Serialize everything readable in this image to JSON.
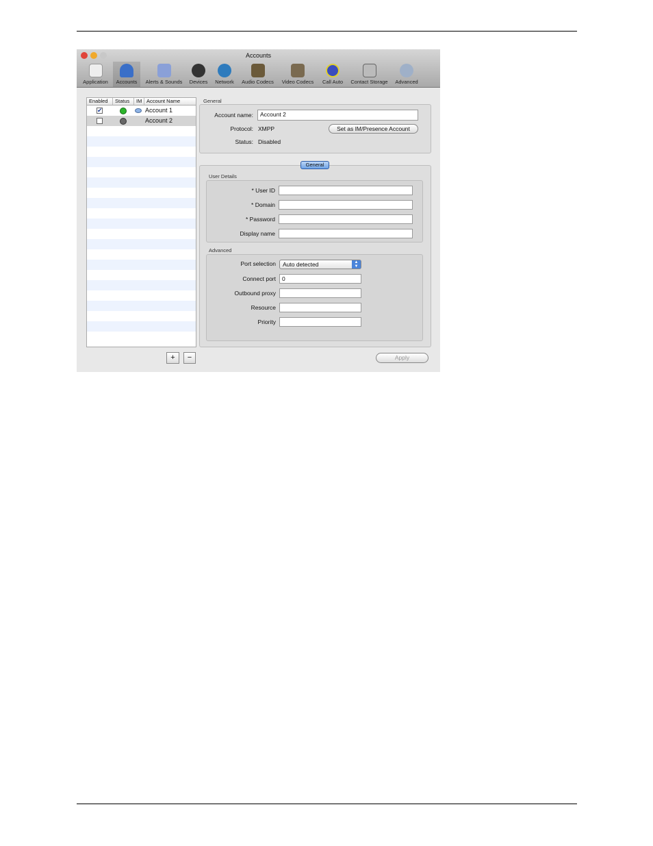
{
  "window": {
    "title": "Accounts"
  },
  "toolbar": [
    {
      "label": "Application",
      "icon": "switch-icon"
    },
    {
      "label": "Accounts",
      "icon": "person-icon",
      "selected": true
    },
    {
      "label": "Alerts & Sounds",
      "icon": "megaphone-icon"
    },
    {
      "label": "Devices",
      "icon": "headset-icon"
    },
    {
      "label": "Network",
      "icon": "globe-icon"
    },
    {
      "label": "Audio Codecs",
      "icon": "audio-chip-icon"
    },
    {
      "label": "Video Codecs",
      "icon": "video-chip-icon"
    },
    {
      "label": "Call Auto",
      "icon": "phone-disc-icon"
    },
    {
      "label": "Contact Storage",
      "icon": "storage-icon"
    },
    {
      "label": "Advanced",
      "icon": "gear-icon"
    }
  ],
  "accounts": {
    "headers": [
      "Enabled",
      "Status",
      "IM",
      "Account Name"
    ],
    "rows": [
      {
        "enabled": true,
        "status": "online",
        "im": true,
        "name": "Account 1"
      },
      {
        "enabled": false,
        "status": "offline",
        "im": false,
        "name": "Account 2"
      }
    ],
    "add": "+",
    "remove": "−"
  },
  "general": {
    "group": "General",
    "account_name_label": "Account name:",
    "account_name": "Account 2",
    "protocol_label": "Protocol:",
    "protocol": "XMPP",
    "status_label": "Status:",
    "status": "Disabled",
    "im_button": "Set as IM/Presence Account"
  },
  "tab": "General",
  "user_details": {
    "group": "User Details",
    "fields": [
      {
        "label": "* User ID",
        "value": ""
      },
      {
        "label": "* Domain",
        "value": ""
      },
      {
        "label": "* Password",
        "value": ""
      },
      {
        "label": "Display name",
        "value": ""
      }
    ]
  },
  "advanced": {
    "group": "Advanced",
    "port_selection_label": "Port selection",
    "port_selection": "Auto detected",
    "fields": [
      {
        "label": "Connect port",
        "value": "0"
      },
      {
        "label": "Outbound proxy",
        "value": ""
      },
      {
        "label": "Resource",
        "value": ""
      },
      {
        "label": "Priority",
        "value": ""
      }
    ]
  },
  "apply": "Apply"
}
